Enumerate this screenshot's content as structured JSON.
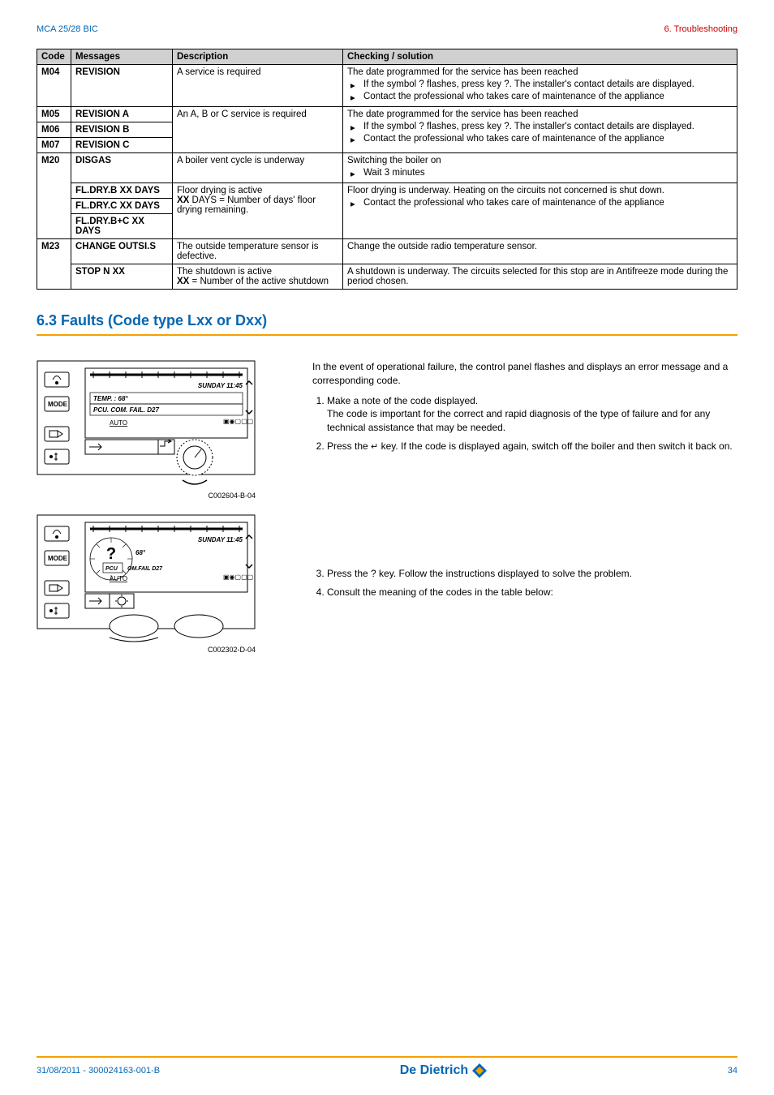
{
  "header": {
    "left": "MCA 25/28 BIC",
    "right": "6.  Troubleshooting"
  },
  "table": {
    "headers": {
      "code": "Code",
      "messages": "Messages",
      "description": "Description",
      "checking": "Checking / solution"
    },
    "rows": [
      {
        "code": "M04",
        "msg": "REVISION",
        "desc": "A service is required",
        "chk_intro": "The date programmed for the service has been reached",
        "chk_bul1": "If the symbol ? flashes, press key ?. The installer's contact details are displayed.",
        "chk_bul2": "Contact the professional who takes care of maintenance of the appliance"
      },
      {
        "code_m05": "M05",
        "msg_a": "REVISION A",
        "code_m06": "M06",
        "msg_b": "REVISION B",
        "code_m07": "M07",
        "msg_c": "REVISION C",
        "desc": "An A, B or C service is required",
        "chk_intro": "The date programmed for the service has been reached",
        "chk_bul1": "If the symbol ? flashes, press key ?. The installer's contact details are displayed.",
        "chk_bul2": "Contact the professional who takes care of maintenance of the appliance"
      },
      {
        "code": "M20",
        "msg": "DISGAS",
        "desc": "A boiler vent cycle is underway",
        "chk_intro": "Switching the boiler on",
        "chk_bul1": "Wait 3 minutes"
      },
      {
        "msg1": "FL.DRY.B XX DAYS",
        "msg2": "FL.DRY.C XX DAYS",
        "msg3": "FL.DRY.B+C XX DAYS",
        "desc_l1": "Floor drying is active",
        "desc_l2_pre": "XX",
        "desc_l2_post": " DAYS = Number of days' floor drying remaining.",
        "chk_intro": "Floor drying is underway. Heating on the circuits not concerned is shut down.",
        "chk_bul1": "Contact the professional who takes care of maintenance of the appliance"
      },
      {
        "code": "M23",
        "msg": "CHANGE OUTSI.S",
        "desc": "The outside temperature sensor is defective.",
        "chk": "Change the outside radio temperature sensor."
      },
      {
        "msg": "STOP N XX",
        "desc_l1": "The shutdown is active",
        "desc_l2_pre": "XX",
        "desc_l2_post": " = Number of the active shutdown",
        "chk": "A shutdown is underway. The circuits selected for this stop are in Antifreeze mode during the period chosen."
      }
    ]
  },
  "section63": {
    "heading": "6.3      Faults (Code type Lxx or Dxx)",
    "intro": "In the event of operational failure, the control panel flashes and displays an error message and a corresponding code.",
    "step1a": "Make a note of the code displayed.",
    "step1b": "The code is important for the correct and rapid diagnosis of the type of failure and for any technical assistance that may be needed.",
    "step2a": "Press the ",
    "step2b": " key. If the code is displayed again, switch off the boiler and then switch it back on.",
    "step3": "Press the ? key. Follow the instructions displayed to solve the problem.",
    "step4": "Consult the meaning of the codes in the table below:",
    "caption1": "C002604-B-04",
    "caption2": "C002302-D-04",
    "panel": {
      "clock": "SUNDAY 11:45",
      "temp_line": "TEMP. :  68°",
      "fail_line": "PCU. COM. FAIL.  D27",
      "auto": "AUTO",
      "mode": "MODE",
      "temp68": "68°",
      "fail_short": "OM.FAIL D27",
      "pcu": "PCU"
    }
  },
  "footer": {
    "left": "31/08/2011  - 300024163-001-B",
    "brand": "De Dietrich",
    "page": "34"
  }
}
